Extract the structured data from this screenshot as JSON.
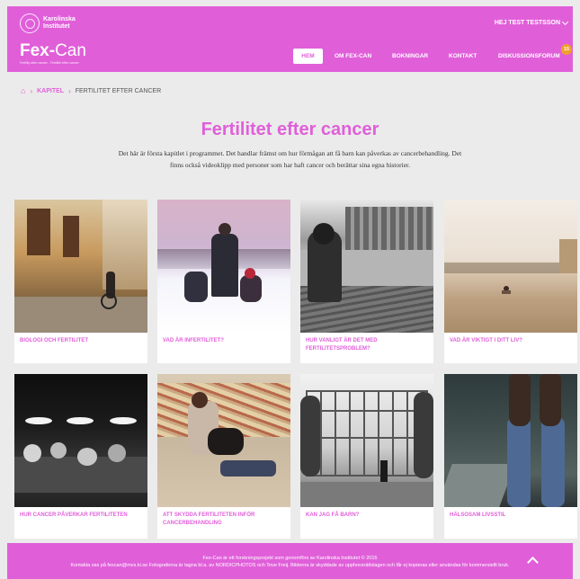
{
  "header": {
    "ki_line1": "Karolinska",
    "ki_line2": "Institutet",
    "brand_bold": "Fex-",
    "brand_light": "Can",
    "brand_tagline": "Fertility after cancer - Fertilitet efter cancer",
    "user_name": "HEJ TEST TESTSSON",
    "badge_count": "15"
  },
  "nav": {
    "items": [
      "HEM",
      "OM FEX-CAN",
      "BOKNINGAR",
      "KONTAKT",
      "DISKUSSIONSFORUM"
    ]
  },
  "breadcrumb": {
    "level1": "KAPITEL",
    "current": "FERTILITET EFTER CANCER"
  },
  "page": {
    "title": "Fertilitet efter cancer",
    "intro": "Det här är första kapitlet i programmet. Det handlar främst om hur förmågan att få barn kan påverkas av cancerbehandling. Det finns också videoklipp med personer som har haft cancer och berättar sina egna historier."
  },
  "cards": [
    {
      "label": "BIOLOGI OCH FERTILITET"
    },
    {
      "label": "VAD ÄR INFERTILITET?"
    },
    {
      "label": "HUR VANLIGT ÄR DET MED FERTILITETSPROBLEM?"
    },
    {
      "label": "VAD ÄR VIKTIGT I DITT LIV?"
    },
    {
      "label": "HUR CANCER PÅVERKAR FERTILITETEN"
    },
    {
      "label": "ATT SKYDDA FERTILITETEN INFÖR CANCERBEHANDLING"
    },
    {
      "label": "KAN JAG FÅ BARN?"
    },
    {
      "label": "HÄLSOSAM LIVSSTIL"
    }
  ],
  "footer": {
    "line1": "Fex-Can är ett forskningsprojekt som genomförs av Karolinska Institutet © 2015",
    "line2": "Kontakta oss på fexcan@mvs.ki.se Fotograferna är tagna bl.a. av NORDICPHOTOS och Tove Freij. Bilderna är skyddade av upphovsrättslagen och får ej kopieras eller användas för kommersiellt bruk."
  },
  "colors": {
    "accent": "#e05fd9",
    "badge": "#f0a12a",
    "background": "#ebebeb"
  }
}
